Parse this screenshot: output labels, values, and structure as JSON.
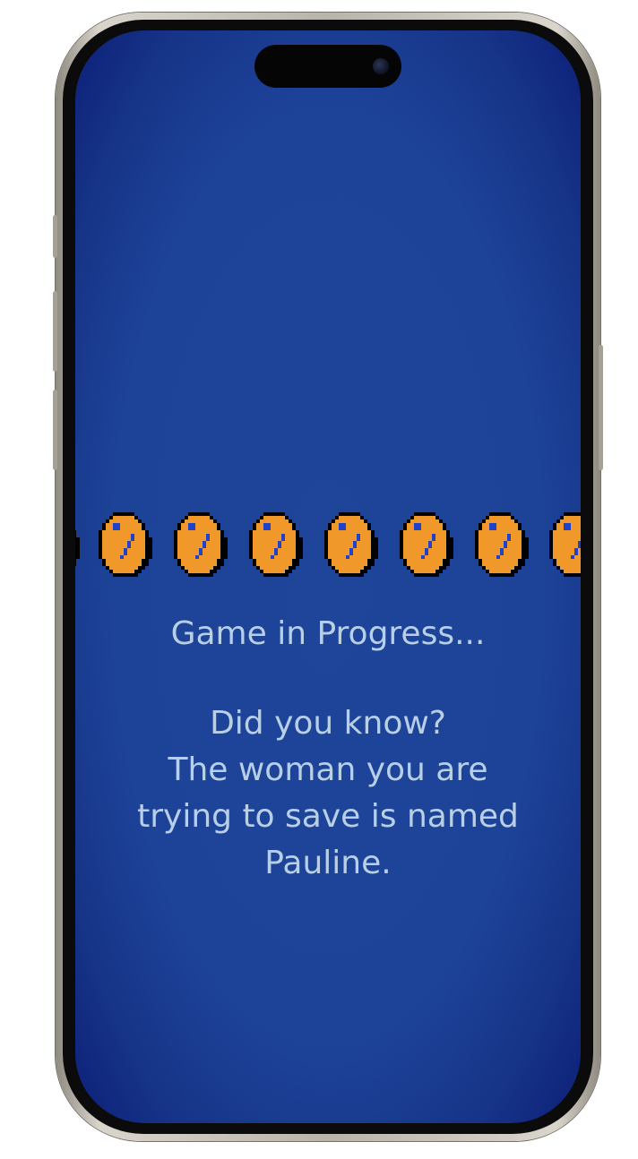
{
  "screen": {
    "background_color": "#1e459a",
    "vignette_color": "#0d1f78"
  },
  "status": {
    "title": "Game in Progress..."
  },
  "fact": {
    "heading": "Did you know?",
    "lines": [
      "The woman you are",
      "trying to save is named",
      "Pauline."
    ]
  },
  "coins": {
    "icon": "pixel-coin-icon",
    "fill_color": "#f0982a",
    "mark_color": "#2041c8",
    "outline_color": "#000000"
  },
  "text_color": "#b8cfe6"
}
